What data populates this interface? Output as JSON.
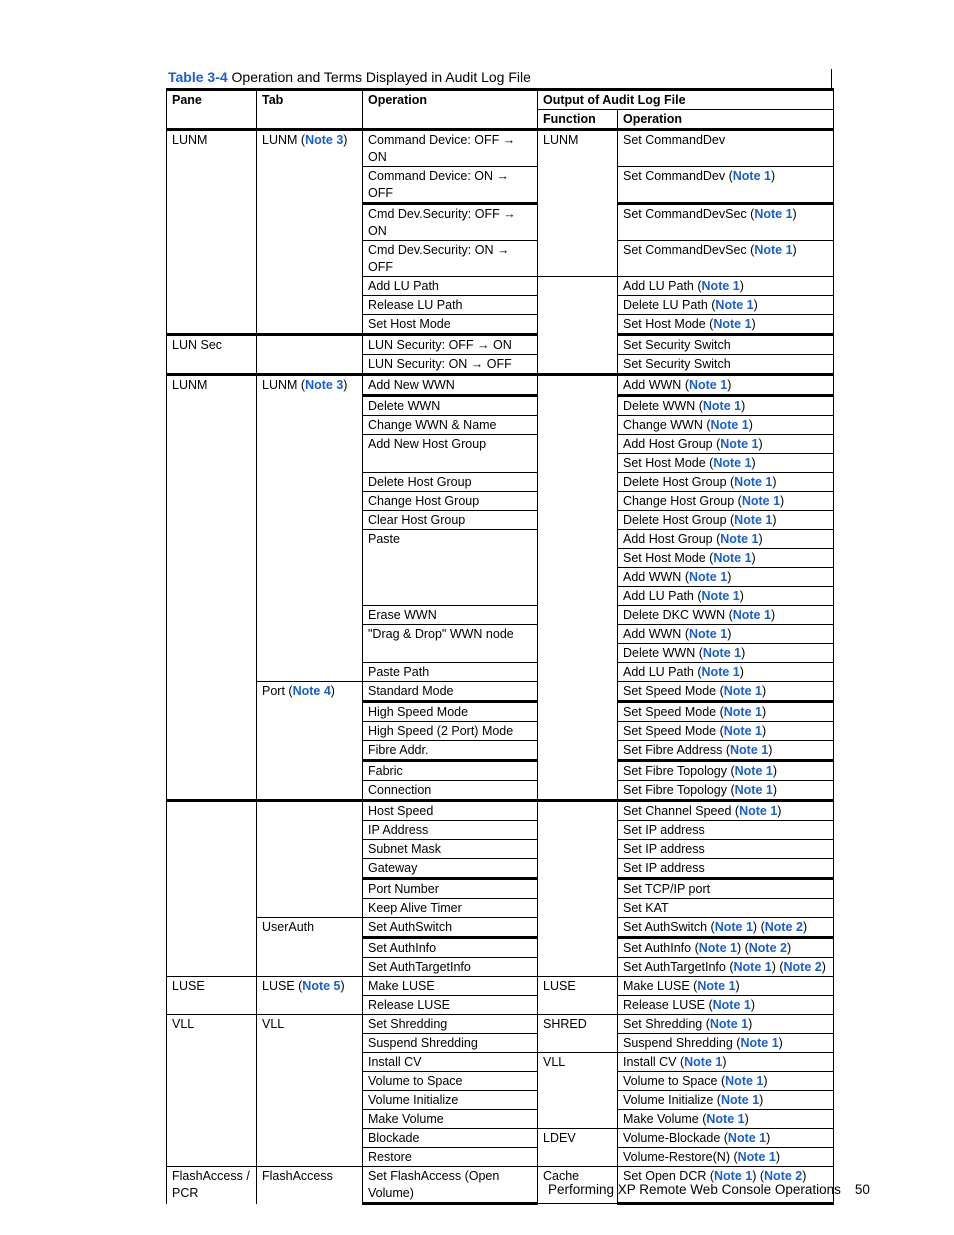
{
  "caption": {
    "table_number": "Table 3-4",
    "title": "Operation and Terms Displayed in Audit Log File"
  },
  "headers": {
    "pane": "Pane",
    "tab": "Tab",
    "operation": "Operation",
    "output_group": "Output of Audit Log File",
    "function": "Function",
    "output_operation": "Operation"
  },
  "rows": [
    {
      "pane": "LUNM",
      "pane_span": 7,
      "tab": "LUNM",
      "tab_note": "Note 3",
      "tab_span": 7,
      "op": "Command Device: OFF → ON",
      "op_span": 1,
      "op_two": true,
      "fn": "LUNM",
      "fn_span": 4,
      "out": "Set CommandDev",
      "notes": []
    },
    {
      "op": "Command Device: ON → OFF",
      "op_span": 1,
      "op_two": true,
      "out": "Set CommandDev",
      "notes": [
        "Note 1"
      ]
    },
    {
      "op": "Cmd Dev.Security: OFF → ON",
      "op_span": 1,
      "op_two": true,
      "out": "Set CommandDevSec",
      "notes": [
        "Note 1"
      ],
      "thick": true
    },
    {
      "op": "Cmd Dev.Security: ON → OFF",
      "op_span": 1,
      "op_two": true,
      "out": "Set CommandDevSec",
      "notes": [
        "Note 1"
      ]
    },
    {
      "op": "Add LU Path",
      "op_span": 1,
      "fn": "",
      "fn_span": 5,
      "out": "Add LU Path",
      "notes": [
        "Note 1"
      ]
    },
    {
      "op": "Release LU Path",
      "op_span": 1,
      "out": "Delete LU Path",
      "notes": [
        "Note 1"
      ]
    },
    {
      "op": "Set Host Mode",
      "op_span": 1,
      "out": "Set Host Mode",
      "notes": [
        "Note 1"
      ]
    },
    {
      "group": true,
      "pane": "LUN Sec",
      "pane_span": 2,
      "tab": "",
      "tab_span": 2,
      "op": "LUN Security: OFF → ON",
      "op_span": 1,
      "out": "Set Security Switch",
      "notes": []
    },
    {
      "op": "LUN Security: ON → OFF",
      "op_span": 1,
      "out": "Set Security Switch",
      "notes": []
    },
    {
      "group": true,
      "pane": "LUNM",
      "pane_span": 22,
      "tab": "LUNM",
      "tab_note": "Note 3",
      "tab_span": 16,
      "op": "Add New WWN",
      "op_span": 1,
      "fn": "",
      "fn_span": 22,
      "out": "Add WWN",
      "notes": [
        "Note 1"
      ]
    },
    {
      "op": "Delete WWN",
      "op_span": 1,
      "out": "Delete WWN",
      "notes": [
        "Note 1"
      ],
      "thick": true
    },
    {
      "op": "Change WWN & Name",
      "op_span": 1,
      "out": "Change WWN",
      "notes": [
        "Note 1"
      ]
    },
    {
      "op": "Add New Host Group",
      "op_span": 2,
      "out": "Add Host Group",
      "notes": [
        "Note 1"
      ]
    },
    {
      "out": "Set Host Mode",
      "notes": [
        "Note 1"
      ]
    },
    {
      "op": "Delete Host Group",
      "op_span": 1,
      "out": "Delete Host Group",
      "notes": [
        "Note 1"
      ]
    },
    {
      "op": "Change Host Group",
      "op_span": 1,
      "out": "Change Host Group",
      "notes": [
        "Note 1"
      ]
    },
    {
      "op": "Clear Host Group",
      "op_span": 1,
      "out": "Delete Host Group",
      "notes": [
        "Note 1"
      ]
    },
    {
      "op": "Paste",
      "op_span": 4,
      "out": "Add Host Group",
      "notes": [
        "Note 1"
      ]
    },
    {
      "out": "Set Host Mode",
      "notes": [
        "Note 1"
      ]
    },
    {
      "out": "Add WWN",
      "notes": [
        "Note 1"
      ]
    },
    {
      "out": "Add LU Path",
      "notes": [
        "Note 1"
      ]
    },
    {
      "op": "Erase WWN",
      "op_span": 1,
      "out": "Delete DKC WWN",
      "notes": [
        "Note 1"
      ]
    },
    {
      "op": "\"Drag & Drop\" WWN node",
      "op_span": 2,
      "out": "Add WWN",
      "notes": [
        "Note 1"
      ]
    },
    {
      "out": "Delete WWN",
      "notes": [
        "Note 1"
      ]
    },
    {
      "op": "Paste Path",
      "op_span": 1,
      "out": "Add LU Path",
      "notes": [
        "Note 1"
      ]
    },
    {
      "tab": "Port",
      "tab_note": "Note 4",
      "tab_span": 6,
      "op": "Standard Mode",
      "op_span": 1,
      "out": "Set Speed Mode",
      "notes": [
        "Note 1"
      ]
    },
    {
      "op": "High Speed Mode",
      "op_span": 1,
      "out": "Set Speed Mode",
      "notes": [
        "Note 1"
      ],
      "thick": true
    },
    {
      "op": "High Speed (2 Port) Mode",
      "op_span": 1,
      "out": "Set Speed Mode",
      "notes": [
        "Note 1"
      ]
    },
    {
      "op": "Fibre Addr.",
      "op_span": 1,
      "out": "Set Fibre Address",
      "notes": [
        "Note 1"
      ]
    },
    {
      "op": "Fabric",
      "op_span": 1,
      "out": "Set Fibre Topology",
      "notes": [
        "Note 1"
      ],
      "thick": true
    },
    {
      "op": "Connection",
      "op_span": 1,
      "out": "Set Fibre Topology",
      "notes": [
        "Note 1"
      ]
    },
    {
      "group": true,
      "pane": "",
      "pane_span": 9,
      "tab": "",
      "tab_span": 6,
      "op": "Host Speed",
      "op_span": 1,
      "fn": "",
      "fn_span": 9,
      "out": "Set Channel Speed",
      "notes": [
        "Note 1"
      ]
    },
    {
      "op": "IP Address",
      "op_span": 1,
      "out": "Set IP address",
      "notes": []
    },
    {
      "op": "Subnet Mask",
      "op_span": 1,
      "out": "Set IP address",
      "notes": []
    },
    {
      "op": "Gateway",
      "op_span": 1,
      "out": "Set IP address",
      "notes": []
    },
    {
      "op": "Port Number",
      "op_span": 1,
      "out": "Set TCP/IP port",
      "notes": [],
      "thick": true
    },
    {
      "op": "Keep Alive Timer",
      "op_span": 1,
      "out": "Set KAT",
      "notes": []
    },
    {
      "tab": "UserAuth",
      "tab_span": 3,
      "op": "Set AuthSwitch",
      "op_span": 1,
      "out": "Set AuthSwitch",
      "notes": [
        "Note 1",
        "Note 2"
      ]
    },
    {
      "op": "Set AuthInfo",
      "op_span": 1,
      "out": "Set AuthInfo",
      "notes": [
        "Note 1",
        "Note 2"
      ],
      "thick": true
    },
    {
      "op": "Set AuthTargetInfo",
      "op_span": 1,
      "out": "Set AuthTargetInfo",
      "notes": [
        "Note 1",
        "Note 2"
      ]
    },
    {
      "pane": "LUSE",
      "pane_span": 2,
      "tab": "LUSE",
      "tab_note": "Note 5",
      "tab_span": 2,
      "op": "Make LUSE",
      "op_span": 1,
      "fn": "LUSE",
      "fn_span": 2,
      "out": "Make LUSE",
      "notes": [
        "Note 1"
      ]
    },
    {
      "op": "Release LUSE",
      "op_span": 1,
      "out": "Release LUSE",
      "notes": [
        "Note 1"
      ]
    },
    {
      "pane": "VLL",
      "pane_span": 8,
      "tab": "VLL",
      "tab_span": 8,
      "op": "Set Shredding",
      "op_span": 1,
      "fn": "SHRED",
      "fn_span": 2,
      "out": "Set Shredding",
      "notes": [
        "Note 1"
      ]
    },
    {
      "op": "Suspend Shredding",
      "op_span": 1,
      "out": "Suspend Shredding",
      "notes": [
        "Note 1"
      ]
    },
    {
      "op": "Install CV",
      "op_span": 1,
      "fn": "VLL",
      "fn_span": 4,
      "out": "Install CV",
      "notes": [
        "Note 1"
      ]
    },
    {
      "op": "Volume to Space",
      "op_span": 1,
      "out": "Volume to Space",
      "notes": [
        "Note 1"
      ]
    },
    {
      "op": "Volume Initialize",
      "op_span": 1,
      "out": "Volume Initialize",
      "notes": [
        "Note 1"
      ]
    },
    {
      "op": "Make Volume",
      "op_span": 1,
      "out": "Make Volume",
      "notes": [
        "Note 1"
      ]
    },
    {
      "op": "Blockade",
      "op_span": 1,
      "fn": "LDEV",
      "fn_span": 2,
      "out": "Volume-Blockade",
      "notes": [
        "Note 1"
      ]
    },
    {
      "op": "Restore",
      "op_span": 1,
      "out": "Volume-Restore(N)",
      "notes": [
        "Note 1"
      ]
    },
    {
      "last": true,
      "pane": "FlashAccess / PCR",
      "pane_span": 1,
      "tab": "FlashAccess",
      "tab_span": 1,
      "op": "Set FlashAccess (Open Volume)",
      "op_span": 1,
      "op_two": true,
      "fn": "Cache",
      "fn_span": 1,
      "out": "Set Open DCR",
      "notes": [
        "Note 1",
        "Note 2"
      ]
    }
  ],
  "footer": {
    "section_title": "Performing XP Remote Web Console Operations",
    "page_number": "50"
  }
}
